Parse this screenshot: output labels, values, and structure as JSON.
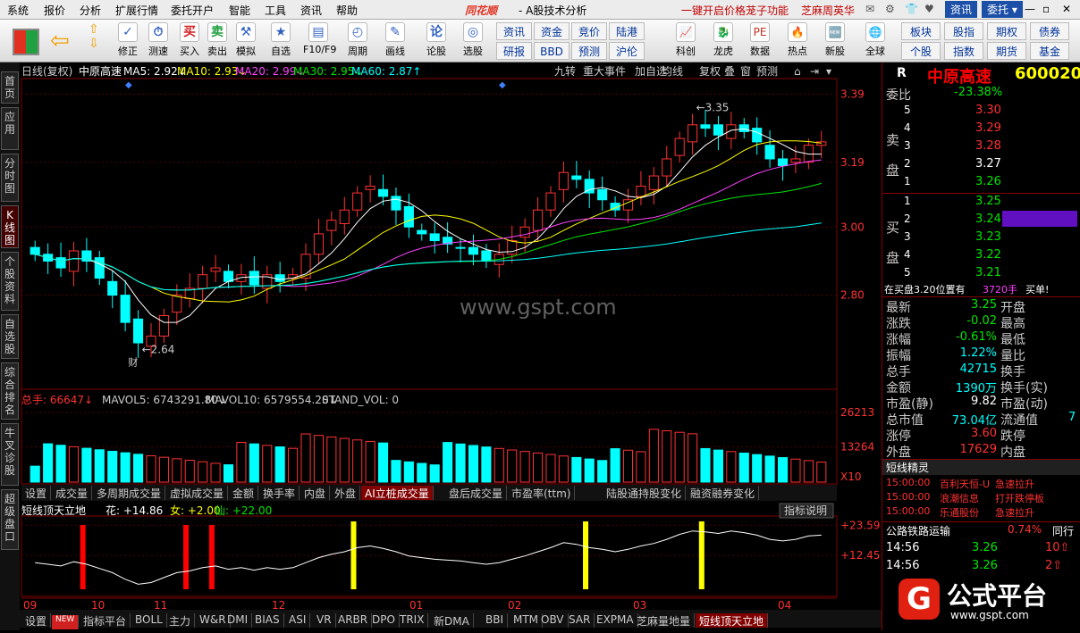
{
  "menu": [
    "系统",
    "报价",
    "分析",
    "扩展行情",
    "委托开户",
    "智能",
    "工具",
    "资讯",
    "帮助"
  ],
  "title": {
    "brand": "同花顺",
    "sub": "A股技术分析"
  },
  "promo": {
    "a": "一键开启价格茏子功能",
    "b": "芝麻周英华"
  },
  "top_right": {
    "news": "资讯",
    "trade": "委托"
  },
  "toolbar": [
    "修正",
    "测速",
    "买入",
    "卖出",
    "模拟",
    "自选",
    "F10/F9",
    "周期",
    "画线",
    "论股",
    "选股"
  ],
  "toolbar_small": [
    "资讯",
    "资金",
    "竞价",
    "陆港",
    "研报",
    "BBD",
    "预测",
    "沪伦"
  ],
  "toolbar2": [
    "科创",
    "龙虎",
    "数据",
    "热点",
    "新股",
    "全球"
  ],
  "toolbar_right": [
    "板块",
    "股指",
    "期权",
    "债券",
    "个股",
    "指数",
    "期货",
    "基金"
  ],
  "left_tabs": [
    "首页",
    "应用",
    "分时图",
    "K线图",
    "个股资料",
    "自选股",
    "综合排名",
    "牛叉诊股",
    "超级盘口"
  ],
  "kline": {
    "header": "日线(复权)",
    "name": "中原高速",
    "ma": [
      {
        "t": "MA5: 2.92",
        "c": "#ffffff"
      },
      {
        "t": "MA10: 2.93",
        "c": "#ffff00"
      },
      {
        "t": "MA20: 2.99",
        "c": "#ff40ff"
      },
      {
        "t": "MA30: 2.95",
        "c": "#00e600"
      },
      {
        "t": "MA60: 2.87",
        "c": "#00ffff"
      }
    ],
    "buttons": [
      "九转",
      "重大事件",
      "加自选",
      "均线",
      "复权",
      "叠",
      "窗",
      "预测"
    ],
    "price_ticks": [
      "3.39",
      "3.19",
      "3.00",
      "2.80"
    ],
    "hi_label": "3.35",
    "lo_label": "2.64",
    "cai": "财",
    "watermark": "www.gspt.com"
  },
  "volume": {
    "header": "总手: 66647",
    "mavol5": "MAVOL5: 6743291.80",
    "mavol10": "MAVOL10: 6579554.20",
    "stand": "STAND_VOL: 0",
    "ticks": [
      "26213",
      "13264"
    ],
    "unit": "X10"
  },
  "vol_tabs": [
    "设置",
    "成交量",
    "多周期成交量",
    "虚拟成交量",
    "金额",
    "换手率",
    "内盘",
    "外盘",
    "AI立桩成交量",
    "盘后成交量",
    "市盈率(ttm)",
    "陆股通持股变化",
    "融资融券变化"
  ],
  "indicator": {
    "name": "短线顶天立地",
    "hua": "花: +14.86",
    "nv": "女: +2.00",
    "xian": "仙: +22.00",
    "explain": "指标说明",
    "ticks": [
      "+23.59",
      "+12.45"
    ]
  },
  "dates": [
    "09",
    "10",
    "11",
    "12",
    "01",
    "02",
    "03",
    "04"
  ],
  "bottom_tabs": [
    "设置",
    "NEW",
    "指标平台",
    "BOLL",
    "主力",
    "W&R",
    "DMI",
    "BIAS",
    "ASI",
    "VR",
    "ARBR",
    "DPO",
    "TRIX",
    "新DMA",
    "BBI",
    "MTM",
    "OBV",
    "SAR",
    "EXPMA",
    "芝麻量地量",
    "短线顶天立地"
  ],
  "stock": {
    "code": "600020",
    "name": "中原高速",
    "r": "R",
    "weibi_label": "委比",
    "weibi": "-23.38%",
    "sell_label": "卖盘",
    "buy_label": "买盘",
    "asks": [
      {
        "n": "5",
        "p": "3.30"
      },
      {
        "n": "4",
        "p": "3.29"
      },
      {
        "n": "3",
        "p": "3.28"
      },
      {
        "n": "2",
        "p": "3.27"
      },
      {
        "n": "1",
        "p": "3.26"
      }
    ],
    "bids": [
      {
        "n": "1",
        "p": "3.25"
      },
      {
        "n": "2",
        "p": "3.24"
      },
      {
        "n": "3",
        "p": "3.23"
      },
      {
        "n": "4",
        "p": "3.22"
      },
      {
        "n": "5",
        "p": "3.21"
      }
    ],
    "order_note": "在买盘3.20位置有",
    "order_qty": "3720手",
    "order_act": "买单!",
    "stats": [
      {
        "k": "最新",
        "v": "3.25",
        "k2": "开盘",
        "c": "grn"
      },
      {
        "k": "涨跌",
        "v": "-0.02",
        "k2": "最高",
        "c": "grn"
      },
      {
        "k": "涨幅",
        "v": "-0.61%",
        "k2": "最低",
        "c": "grn"
      },
      {
        "k": "振幅",
        "v": "1.22%",
        "k2": "量比",
        "c": "cyn"
      },
      {
        "k": "总手",
        "v": "42715",
        "k2": "换手",
        "c": "cyn"
      },
      {
        "k": "金额",
        "v": "1390万",
        "k2": "换手(实)",
        "c": "cyn"
      },
      {
        "k": "市盈(静)",
        "v": "9.82",
        "k2": "市盈(动)",
        "c": "wht"
      },
      {
        "k": "总市值",
        "v": "73.04亿",
        "k2": "流通值",
        "c": "cyn"
      },
      {
        "k": "涨停",
        "v": "3.60",
        "k2": "跌停",
        "c": "red"
      },
      {
        "k": "外盘",
        "v": "17629",
        "k2": "内盘",
        "c": "red"
      }
    ],
    "liutong_tail": "7",
    "jingling_title": "短线精灵",
    "jingling": [
      {
        "t": "15:00:00",
        "n": "百利天恒-U",
        "e": "急速拉升"
      },
      {
        "t": "15:00:00",
        "n": "浪潮信息",
        "e": "打开跌停板"
      },
      {
        "t": "15:00:00",
        "n": "乐通股份",
        "e": "急速拉升"
      }
    ],
    "sector": {
      "name": "公路铁路运输",
      "pct": "0.74%",
      "same": "同行"
    },
    "ticks": [
      {
        "t": "14:56",
        "p": "3.26",
        "v": "10"
      },
      {
        "t": "14:56",
        "p": "3.26",
        "v": "2"
      }
    ]
  },
  "logo": {
    "text": "公式平台",
    "url": "www.gspt.com"
  },
  "chart_data": {
    "type": "candlestick",
    "price_range": [
      2.55,
      3.42
    ],
    "volume_max": 26213,
    "indicator_range": [
      0,
      25
    ],
    "candles_approx_close": [
      2.92,
      2.9,
      2.88,
      2.93,
      2.9,
      2.85,
      2.8,
      2.72,
      2.66,
      2.68,
      2.74,
      2.8,
      2.82,
      2.86,
      2.88,
      2.84,
      2.86,
      2.83,
      2.86,
      2.84,
      2.86,
      2.92,
      2.98,
      3.02,
      3.05,
      3.1,
      3.12,
      3.09,
      3.05,
      3.0,
      2.98,
      2.96,
      2.95,
      2.94,
      2.92,
      2.9,
      2.92,
      2.96,
      3.0,
      3.05,
      3.1,
      3.16,
      3.14,
      3.1,
      3.08,
      3.05,
      3.08,
      3.12,
      3.15,
      3.2,
      3.26,
      3.3,
      3.29,
      3.27,
      3.3,
      3.28,
      3.25,
      3.2,
      3.18,
      3.2,
      3.24,
      3.25
    ]
  }
}
